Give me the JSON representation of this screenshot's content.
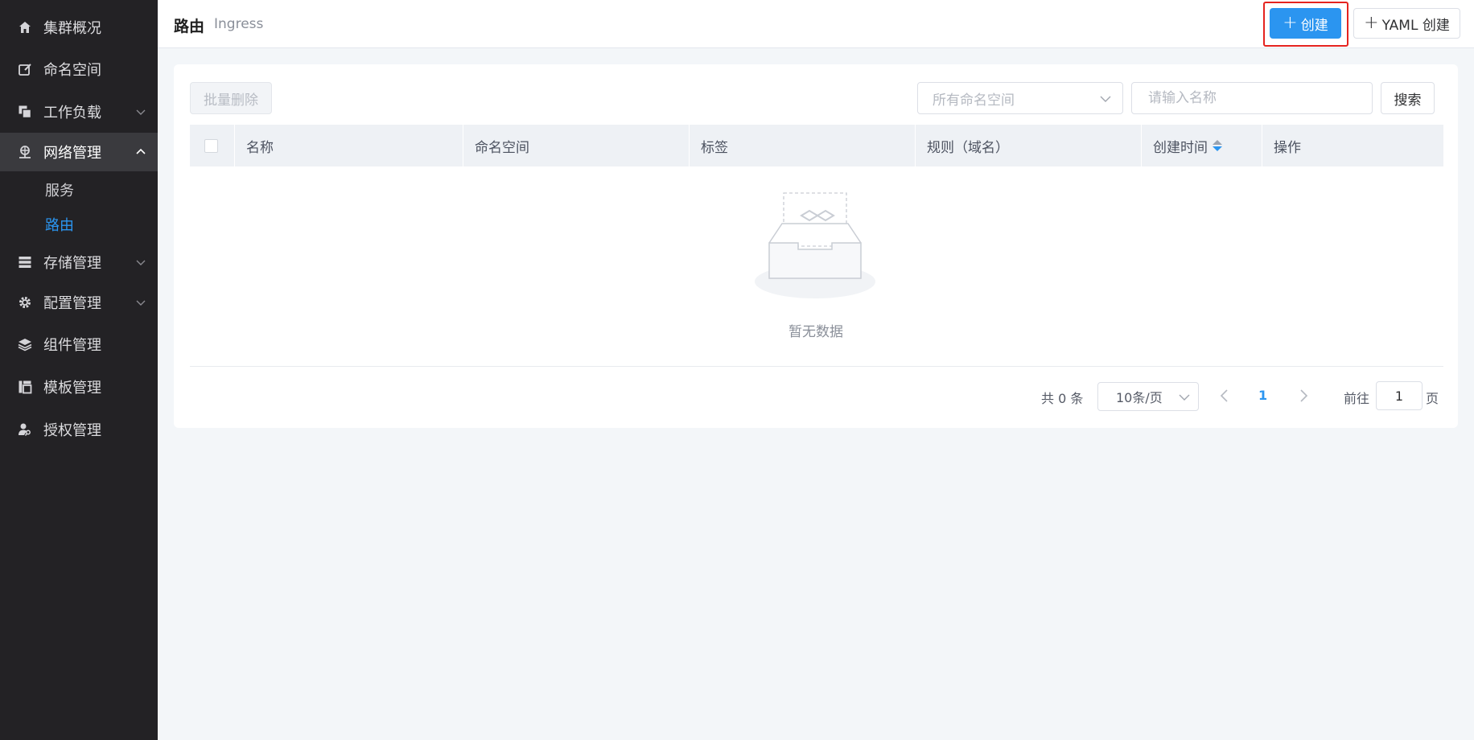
{
  "sidebar": {
    "items": [
      {
        "label": "集群概况",
        "icon": "home-icon"
      },
      {
        "label": "命名空间",
        "icon": "edit-icon"
      },
      {
        "label": "工作负载",
        "icon": "copy-icon"
      },
      {
        "label": "网络管理",
        "icon": "network-icon"
      },
      {
        "label": "存储管理",
        "icon": "storage-icon"
      },
      {
        "label": "配置管理",
        "icon": "gear-icon"
      },
      {
        "label": "组件管理",
        "icon": "layers-icon"
      },
      {
        "label": "模板管理",
        "icon": "template-icon"
      },
      {
        "label": "授权管理",
        "icon": "user-key-icon"
      }
    ],
    "sub_items": [
      {
        "label": "服务"
      },
      {
        "label": "路由"
      }
    ]
  },
  "header": {
    "title": "路由",
    "subtitle": "Ingress",
    "create_label": "创建",
    "yaml_create_label": "YAML 创建"
  },
  "toolbar": {
    "batch_delete_label": "批量删除",
    "namespace_placeholder": "所有命名空间",
    "name_placeholder": "请输入名称",
    "search_label": "搜索"
  },
  "table": {
    "columns": [
      "名称",
      "命名空间",
      "标签",
      "规则（域名）",
      "创建时间",
      "操作"
    ],
    "empty_text": "暂无数据"
  },
  "pagination": {
    "total": "共 0 条",
    "page_size": "10条/页",
    "current_page": "1",
    "goto_label": "前往",
    "goto_value": "1",
    "page_suffix": "页"
  },
  "colors": {
    "accent": "#2b95f0",
    "sidebar_bg": "#232225",
    "highlight_border": "#e5231f"
  }
}
